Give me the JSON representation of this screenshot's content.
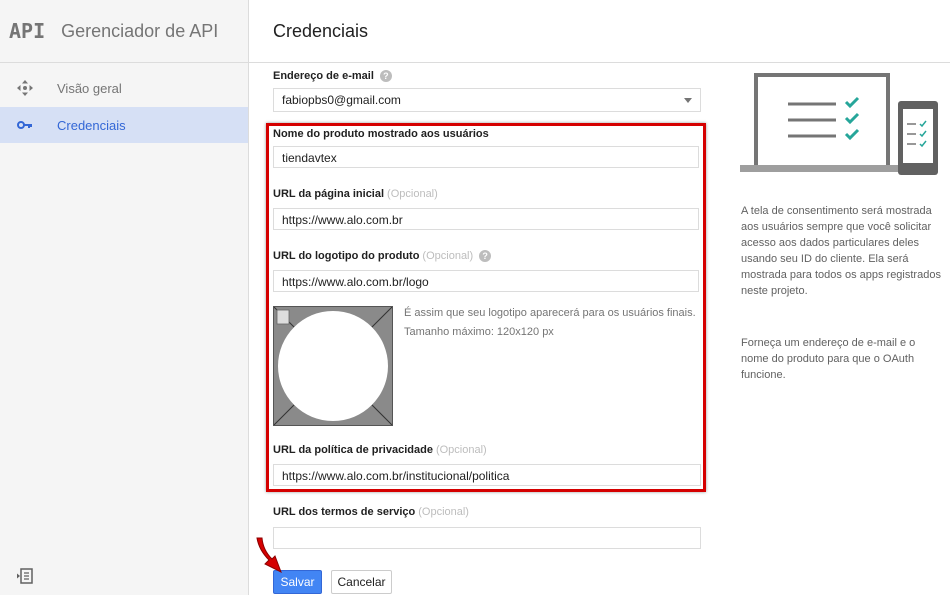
{
  "sidebar": {
    "logo": "API",
    "title": "Gerenciador de API",
    "items": [
      {
        "label": "Visão geral",
        "icon": "overview-icon",
        "active": false
      },
      {
        "label": "Credenciais",
        "icon": "key-icon",
        "active": true
      }
    ]
  },
  "header": {
    "title": "Credenciais"
  },
  "form": {
    "email": {
      "label": "Endereço de e-mail",
      "value": "fabiopbs0@gmail.com"
    },
    "product_name": {
      "label": "Nome do produto mostrado aos usuários",
      "value": "tiendavtex"
    },
    "homepage": {
      "label": "URL da página inicial",
      "optional": "(Opcional)",
      "value": "https://www.alo.com.br"
    },
    "logo_url": {
      "label": "URL do logotipo do produto",
      "optional": "(Opcional)",
      "value": "https://www.alo.com.br/logo"
    },
    "logo_note": {
      "line1": "É assim que seu logotipo aparecerá para os usuários finais.",
      "line2": "Tamanho máximo: 120x120 px"
    },
    "privacy": {
      "label": "URL da política de privacidade",
      "optional": "(Opcional)",
      "value": "https://www.alo.com.br/institucional/politica"
    },
    "terms": {
      "label": "URL dos termos de serviço",
      "optional": "(Opcional)",
      "value": ""
    },
    "save_label": "Salvar",
    "cancel_label": "Cancelar"
  },
  "info": {
    "para1": "A tela de consentimento será mostrada aos usuários sempre que você solicitar acesso aos dados particulares deles usando seu ID do cliente. Ela será mostrada para todos os apps registrados neste projeto.",
    "para2": "Forneça um endereço de e-mail e o nome do produto para que o OAuth funcione."
  },
  "colors": {
    "accent": "#4285f4",
    "highlight": "#d50000",
    "active_nav": "#d6e0f5",
    "check": "#26a69a"
  }
}
